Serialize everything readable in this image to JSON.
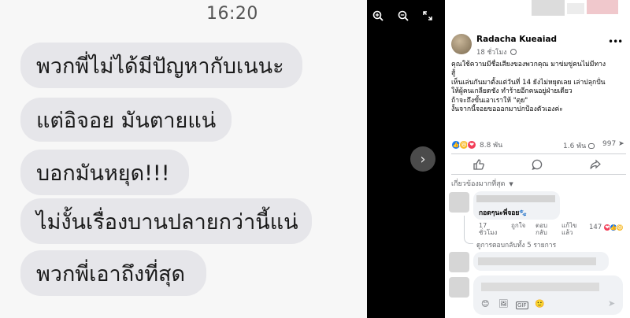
{
  "chat": {
    "time": "16:20",
    "messages": [
      "พวกพี่ไม่ได้มีปัญหากับเนนะ",
      "แต่อิจอย มันตายแน่",
      "บอกมันหยุด!!!",
      "ไม่งั้นเรื่องบานปลายกว่านี้แน่",
      "พวกพี่เอาถึงที่สุด"
    ]
  },
  "media_controls": {
    "zoom_in_icon": "zoom-in-icon",
    "zoom_out_icon": "zoom-out-icon",
    "fullscreen_icon": "fullscreen-icon",
    "next_icon": "chevron-right-icon"
  },
  "post": {
    "author": "Radacha Kueaiad",
    "time": "18 ชั่วโมง",
    "globe_icon": "globe-icon",
    "more_icon": "more-options-icon",
    "text_lines": [
      "คุณใช้ความมีชื่อเสียงของพวกคุณ มาข่มขู่คนไม่มีทาง",
      "สู้",
      "เห็นเล่นกันมาตั้งแต่วันที่ 14 ยังไม่หยุดเลย เล่าปลุกปั่น",
      "ให้ผู้คนเกลียดชัง ทำร้ายอีกคนอยู่ฝ่ายเดียว",
      "ถ้าจะถึงขั้นเอาเราให้ \"ตุย\"",
      "งั้นจากนี้จอยขอออกมาปกป้องตัวเองค่ะ"
    ],
    "reactions_count": "8.8 พัน",
    "comments_count": "1.6 พัน",
    "shares_count": "997",
    "colors": {
      "like": "#1877f2",
      "haha": "#f7b928",
      "love": "#f33e58"
    }
  },
  "actions": {
    "like_icon": "like-icon",
    "comment_icon": "comment-icon",
    "share_icon": "share-icon"
  },
  "comments": {
    "sort_label": "เกี่ยวข้องมากที่สุด",
    "first_comment_text": "กอดๆนะพี่จอย",
    "first_comment_time": [
      "17",
      "ชั่วโมง"
    ],
    "first_comment_like": "ถูกใจ",
    "first_comment_reply": [
      "ตอบ",
      "กลับ"
    ],
    "first_comment_edited": [
      "แก้ไข",
      "แล้ว"
    ],
    "first_comment_reacts": "147",
    "view_replies": "ดูการตอบกลับทั้ง 5 รายการ"
  },
  "composer": {
    "tools": [
      "😊",
      "🖼",
      "GIF",
      "🙂"
    ]
  }
}
